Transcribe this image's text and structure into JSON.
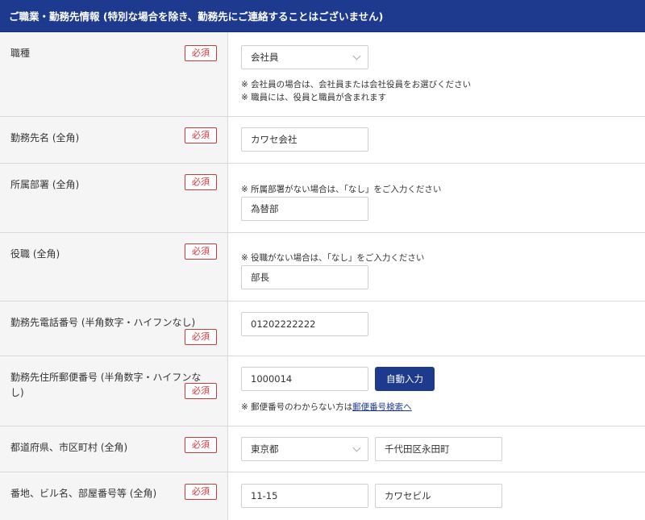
{
  "section": {
    "title": "ご職業・勤務先情報 (特別な場合を除き、勤務先にご連絡することはございません)"
  },
  "required_label": "必須",
  "fields": {
    "occupation": {
      "label": "職種",
      "value": "会社員",
      "note1": "※ 会社員の場合は、会社員または会社役員をお選びください",
      "note2": "※ 職員には、役員と職員が含まれます"
    },
    "company": {
      "label": "勤務先名 (全角)",
      "value": "カワセ会社"
    },
    "department": {
      "label": "所属部署 (全角)",
      "note": "※ 所属部署がない場合は、「なし」をご入力ください",
      "value": "為替部"
    },
    "position": {
      "label": "役職 (全角)",
      "note": "※ 役職がない場合は、「なし」をご入力ください",
      "value": "部長"
    },
    "phone": {
      "label": "勤務先電話番号 (半角数字・ハイフンなし)",
      "value": "01202222222"
    },
    "postal": {
      "label": "勤務先住所郵便番号 (半角数字・ハイフンなし)",
      "value": "1000014",
      "button": "自動入力",
      "note_prefix": "※ 郵便番号のわからない方は",
      "note_link": "郵便番号検索へ"
    },
    "prefecture_city": {
      "label": "都道府県、市区町村 (全角)",
      "prefecture": "東京都",
      "city": "千代田区永田町"
    },
    "address": {
      "label": "番地、ビル名、部屋番号等 (全角)",
      "street": "11-15",
      "building": "カワセビル"
    }
  }
}
